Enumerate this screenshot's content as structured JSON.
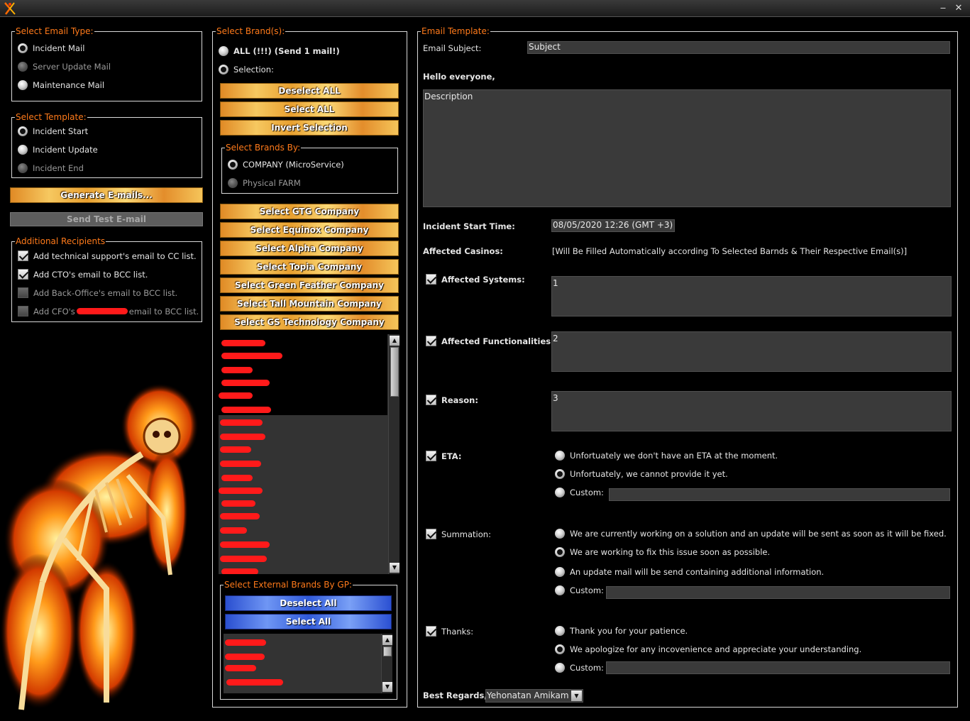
{
  "window": {
    "minimize": "‒",
    "close": "✕"
  },
  "email_type": {
    "legend": "Select Email Type:",
    "options": [
      {
        "label": "Incident Mail",
        "selected": true,
        "enabled": true
      },
      {
        "label": "Server Update Mail",
        "selected": false,
        "enabled": false
      },
      {
        "label": "Maintenance Mail",
        "selected": false,
        "enabled": true
      }
    ]
  },
  "template": {
    "legend": "Select Template:",
    "options": [
      {
        "label": "Incident Start",
        "selected": true,
        "enabled": true
      },
      {
        "label": "Incident Update",
        "selected": false,
        "enabled": true
      },
      {
        "label": "Incident End",
        "selected": false,
        "enabled": false
      }
    ]
  },
  "actions": {
    "generate": "Generate E-mails...",
    "send_test": "Send Test E-mail"
  },
  "recipients": {
    "legend": "Additional Recipients",
    "items": [
      {
        "label": "Add technical support's email to CC list.",
        "checked": true,
        "enabled": true
      },
      {
        "label": "Add CTO's email to BCC list.",
        "checked": true,
        "enabled": true
      },
      {
        "label": "Add Back-Office's email to BCC list.",
        "checked": false,
        "enabled": false
      },
      {
        "label_pre": "Add CFO's",
        "label_post": "email to BCC list.",
        "checked": false,
        "enabled": false
      }
    ]
  },
  "brands": {
    "legend": "Select Brand(s):",
    "all_label": "ALL (!!!) (Send 1 mail!)",
    "selection_label": "Selection:",
    "deselect_all": "Deselect ALL",
    "select_all": "Select ALL",
    "invert": "Invert Selection",
    "by_legend": "Select Brands By:",
    "by_company": "COMPANY (MicroService)",
    "by_farm": "Physical FARM",
    "company_buttons": [
      "Select GTG Company",
      "Select Equinox Company",
      "Select Alpha Company",
      "Select Topia Company",
      "Select Green Feather Company",
      "Select Tall Mountain Company",
      "Select GS Technology Company"
    ]
  },
  "external": {
    "legend": "Select External Brands By GP:",
    "deselect_all": "Deselect All",
    "select_all": "Select All"
  },
  "template_form": {
    "legend": "Email Template:",
    "subject_label": "Email Subject:",
    "subject_value": "Subject",
    "greeting": "Hello everyone,",
    "description": "Description",
    "start_time_label": "Incident Start Time:",
    "start_time_value": "08/05/2020 12:26 (GMT +3)",
    "casinos_label": "Affected Casinos:",
    "casinos_value": "[Will Be Filled Automatically according To Selected Barnds & Their Respective Email(s)]",
    "systems_label": "Affected Systems:",
    "systems_value": "1",
    "functionalities_label": "Affected Functionalities:",
    "functionalities_value": "2",
    "reason_label": "Reason:",
    "reason_value": "3",
    "eta_label": "ETA:",
    "eta_options": [
      "Unfortuately we don't have an ETA at the moment.",
      "Unfortuately, we cannot provide it yet.",
      "Custom:"
    ],
    "summation_label": "Summation:",
    "summation_options": [
      "We are currently working on a solution and an update will be sent as soon as it will be fixed.",
      "We are working to fix this issue soon as possible.",
      "An update mail will be send containing additional information.",
      "Custom:"
    ],
    "thanks_label": "Thanks:",
    "thanks_options": [
      "Thank you for your patience.",
      "We apologize for any incovenience and appreciate your understanding.",
      "Custom:"
    ],
    "regards_label": "Best Regards,",
    "regards_value": "Yehonatan Amikam"
  },
  "colors": {
    "accent": "#ff7a1a",
    "field_bg": "#3a3a3a",
    "redaction": "#ff1a1a"
  }
}
